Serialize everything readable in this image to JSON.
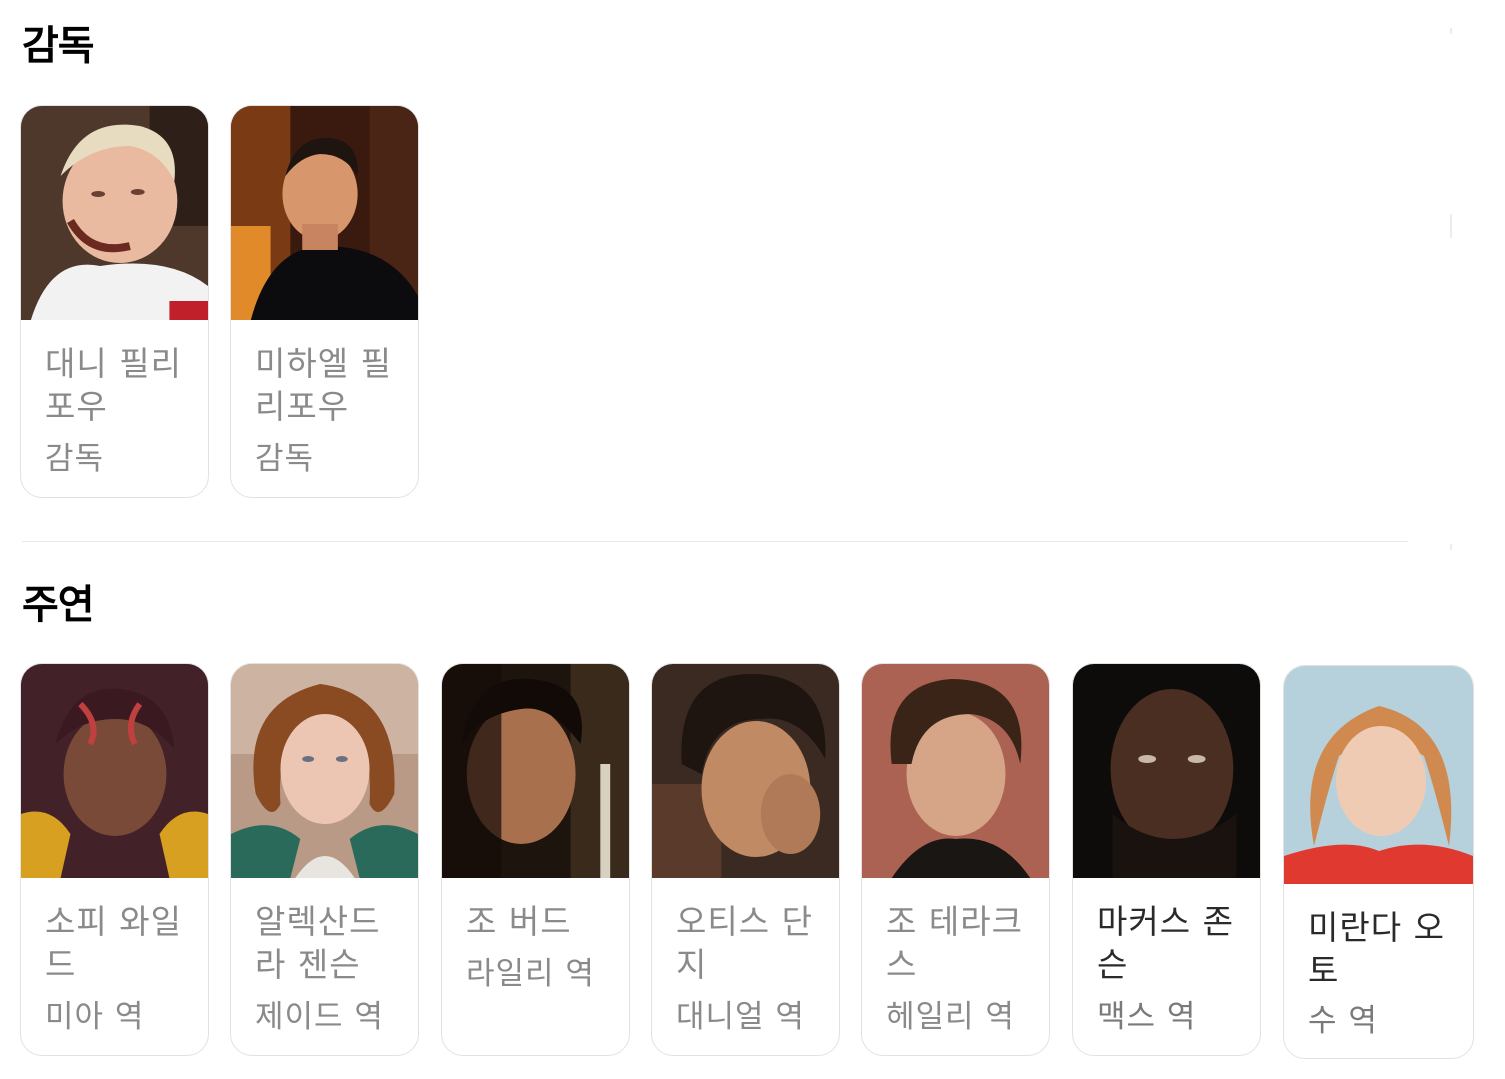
{
  "directors": {
    "title": "감독",
    "people": [
      {
        "name": "대니 필리포우",
        "role": "감독"
      },
      {
        "name": "미하엘 필리포우",
        "role": "감독"
      }
    ]
  },
  "cast": {
    "title": "주연",
    "people": [
      {
        "name": "소피 와일드",
        "role": "미아 역"
      },
      {
        "name": "알렉산드라 젠슨",
        "role": "제이드 역"
      },
      {
        "name": "조 버드",
        "role": "라일리 역"
      },
      {
        "name": "오티스 단지",
        "role": "대니얼 역"
      },
      {
        "name": "조 테라크스",
        "role": "헤일리 역"
      },
      {
        "name": "마커스 존슨",
        "role": "맥스 역"
      },
      {
        "name": "미란다 오토",
        "role": "수 역"
      }
    ]
  },
  "colors": {
    "card_border": "#e2e2e2",
    "text_muted": "#8a8a8a",
    "divider": "#e9e9e9"
  }
}
